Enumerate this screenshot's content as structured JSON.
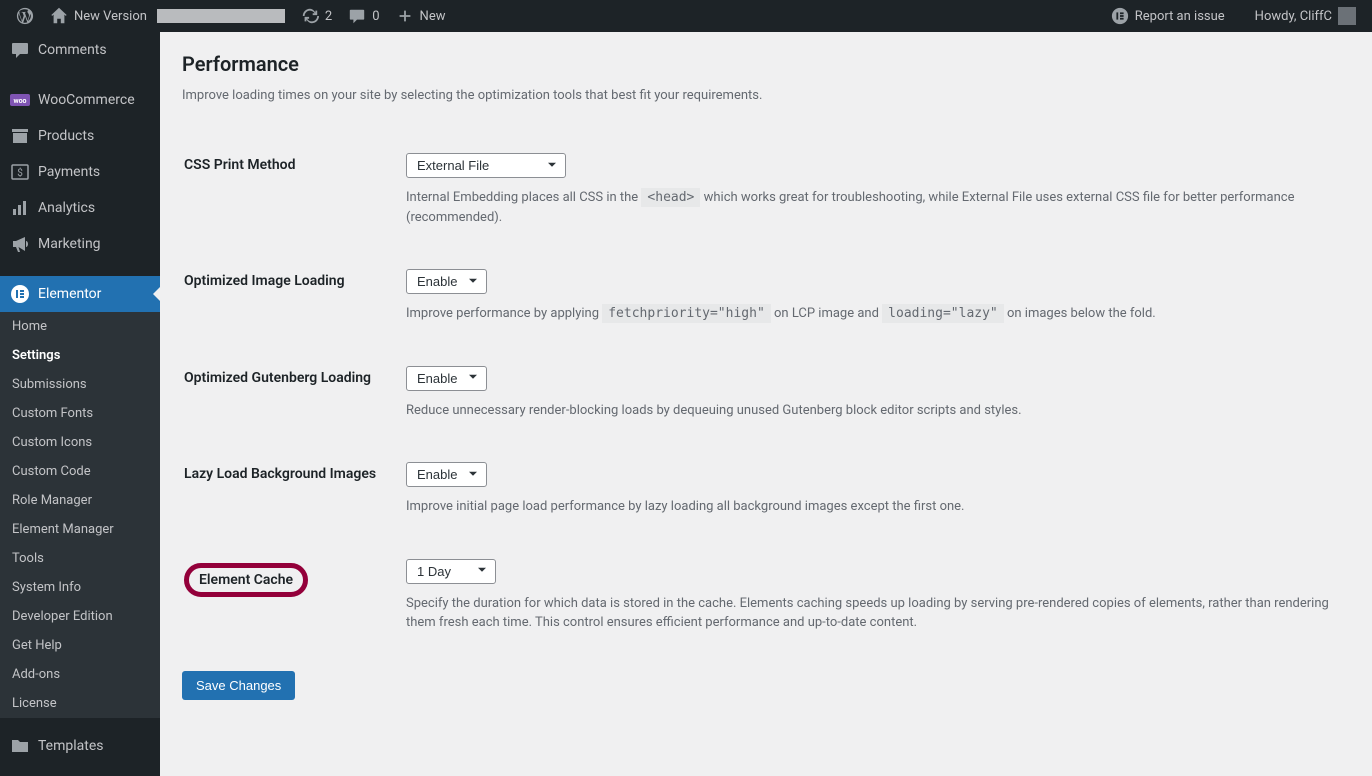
{
  "adminbar": {
    "site_name": "New Version",
    "updates_count": "2",
    "comments_count": "0",
    "new_label": "New",
    "report_issue": "Report an issue",
    "howdy": "Howdy, CliffC"
  },
  "sidebar": {
    "items": [
      {
        "label": "Comments",
        "icon": "comment"
      },
      {
        "label": "WooCommerce",
        "icon": "woo"
      },
      {
        "label": "Products",
        "icon": "archive"
      },
      {
        "label": "Payments",
        "icon": "payments"
      },
      {
        "label": "Analytics",
        "icon": "analytics"
      },
      {
        "label": "Marketing",
        "icon": "megaphone"
      },
      {
        "label": "Elementor",
        "icon": "elementor",
        "current": true
      },
      {
        "label": "Templates",
        "icon": "templates"
      }
    ],
    "submenu": [
      {
        "label": "Home"
      },
      {
        "label": "Settings",
        "active": true
      },
      {
        "label": "Submissions"
      },
      {
        "label": "Custom Fonts"
      },
      {
        "label": "Custom Icons"
      },
      {
        "label": "Custom Code"
      },
      {
        "label": "Role Manager"
      },
      {
        "label": "Element Manager"
      },
      {
        "label": "Tools"
      },
      {
        "label": "System Info"
      },
      {
        "label": "Developer Edition"
      },
      {
        "label": "Get Help"
      },
      {
        "label": "Add-ons"
      },
      {
        "label": "License"
      }
    ]
  },
  "page": {
    "title": "Performance",
    "description": "Improve loading times on your site by selecting the optimization tools that best fit your requirements."
  },
  "settings": {
    "css_print": {
      "label": "CSS Print Method",
      "value": "External File",
      "help_pre": "Internal Embedding places all CSS in the ",
      "help_code": "<head>",
      "help_post": " which works great for troubleshooting, while External File uses external CSS file for better performance (recommended)."
    },
    "opt_image": {
      "label": "Optimized Image Loading",
      "value": "Enable",
      "help_1": "Improve performance by applying ",
      "code_1": "fetchpriority=\"high\"",
      "help_2": " on LCP image and ",
      "code_2": "loading=\"lazy\"",
      "help_3": " on images below the fold."
    },
    "opt_gutenberg": {
      "label": "Optimized Gutenberg Loading",
      "value": "Enable",
      "help": "Reduce unnecessary render-blocking loads by dequeuing unused Gutenberg block editor scripts and styles."
    },
    "lazy_bg": {
      "label": "Lazy Load Background Images",
      "value": "Enable",
      "help": "Improve initial page load performance by lazy loading all background images except the first one."
    },
    "element_cache": {
      "label": "Element Cache",
      "value": "1 Day",
      "help": "Specify the duration for which data is stored in the cache. Elements caching speeds up loading by serving pre-rendered copies of elements, rather than rendering them fresh each time. This control ensures efficient performance and up-to-date content."
    }
  },
  "save_button": "Save Changes"
}
